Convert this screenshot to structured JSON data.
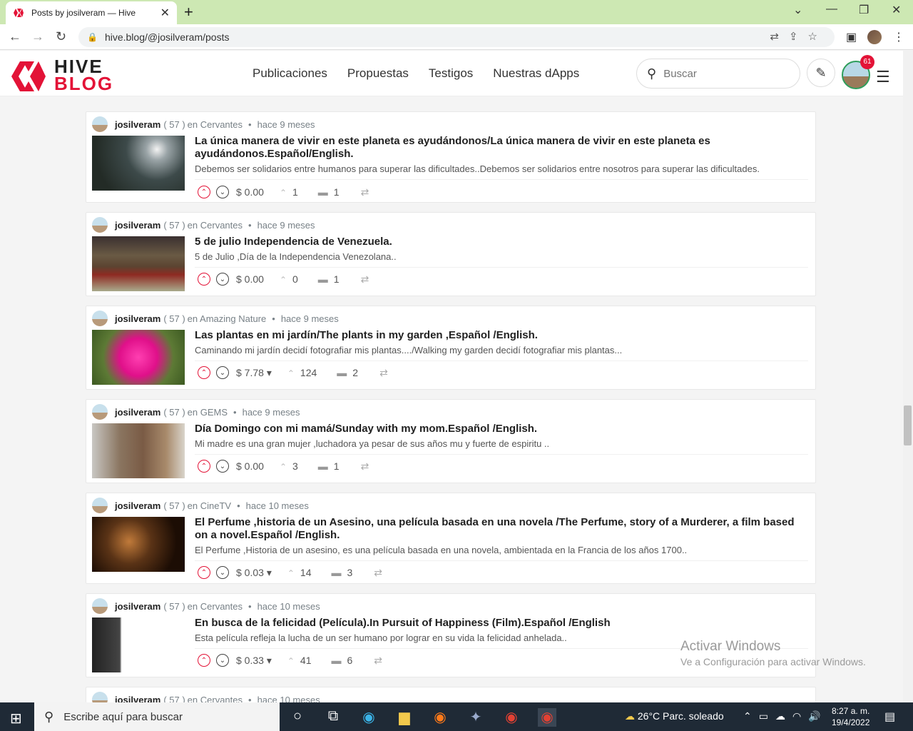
{
  "browser": {
    "tab_title": "Posts by josilveram — Hive",
    "url": "hive.blog/@josilveram/posts"
  },
  "site": {
    "logo_top": "HIVE",
    "logo_bottom": "BLOG",
    "nav": [
      "Publicaciones",
      "Propuestas",
      "Testigos",
      "Nuestras dApps"
    ],
    "search_placeholder": "Buscar",
    "notification_count": "61"
  },
  "posts": [
    {
      "author": "josilveram",
      "reputation": "( 57 )",
      "community": "en Cervantes",
      "time": "hace 9 meses",
      "title": "La única manera de vivir en este planeta es ayudándonos/La única manera de vivir en este planeta es ayudándonos.Español/English.",
      "summary": "Debemos ser solidarios entre humanos para superar las dificultades..Debemos ser solidarios entre nosotros para superar las dificultades.",
      "payout": "$ 0.00",
      "votes": "1",
      "comments": "1"
    },
    {
      "author": "josilveram",
      "reputation": "( 57 )",
      "community": "en Cervantes",
      "time": "hace 9 meses",
      "title": "5 de julio Independencia de Venezuela.",
      "summary": "5 de Julio ,Día de la Independencia Venezolana..",
      "payout": "$ 0.00",
      "votes": "0",
      "comments": "1"
    },
    {
      "author": "josilveram",
      "reputation": "( 57 )",
      "community": "en Amazing Nature",
      "time": "hace 9 meses",
      "title": "Las plantas en mi jardín/The plants in my garden ,Español /English.",
      "summary": "Caminando mi jardín decidí fotografiar mis plantas..../Walking my garden decidí fotografiar mis plantas...",
      "payout": "$ 7.78",
      "votes": "124",
      "comments": "2"
    },
    {
      "author": "josilveram",
      "reputation": "( 57 )",
      "community": "en GEMS",
      "time": "hace 9 meses",
      "title": "Día Domingo con mi mamá/Sunday with my mom.Español /English.",
      "summary": "Mi madre es una gran mujer ,luchadora ya pesar de sus años mu y fuerte de espiritu ..",
      "payout": "$ 0.00",
      "votes": "3",
      "comments": "1"
    },
    {
      "author": "josilveram",
      "reputation": "( 57 )",
      "community": "en CineTV",
      "time": "hace 10 meses",
      "title": "El Perfume ,historia de un Asesino, una película basada en una novela /The Perfume, story of a Murderer, a film based on a novel.Español /English.",
      "summary": "El Perfume ,Historia de un asesino, es una película basada en una novela, ambientada en la Francia de los años 1700..",
      "payout": "$ 0.03",
      "votes": "14",
      "comments": "3"
    },
    {
      "author": "josilveram",
      "reputation": "( 57 )",
      "community": "en Cervantes",
      "time": "hace 10 meses",
      "title": "En busca de la felicidad (Película).In Pursuit of Happiness (Film).Español /English",
      "summary": "Esta película refleja la lucha de un ser humano por lograr en su vida la felicidad anhelada..",
      "payout": "$ 0.33",
      "votes": "41",
      "comments": "6"
    },
    {
      "author": "josilveram",
      "reputation": "( 57 )",
      "community": "en Cervantes",
      "time": "hace 10 meses"
    }
  ],
  "watermark": {
    "line1": "Activar Windows",
    "line2": "Ve a Configuración para activar Windows."
  },
  "taskbar": {
    "search_placeholder": "Escribe aquí para buscar",
    "weather": "26°C  Parc. soleado",
    "time": "8:27 a. m.",
    "date": "19/4/2022"
  }
}
